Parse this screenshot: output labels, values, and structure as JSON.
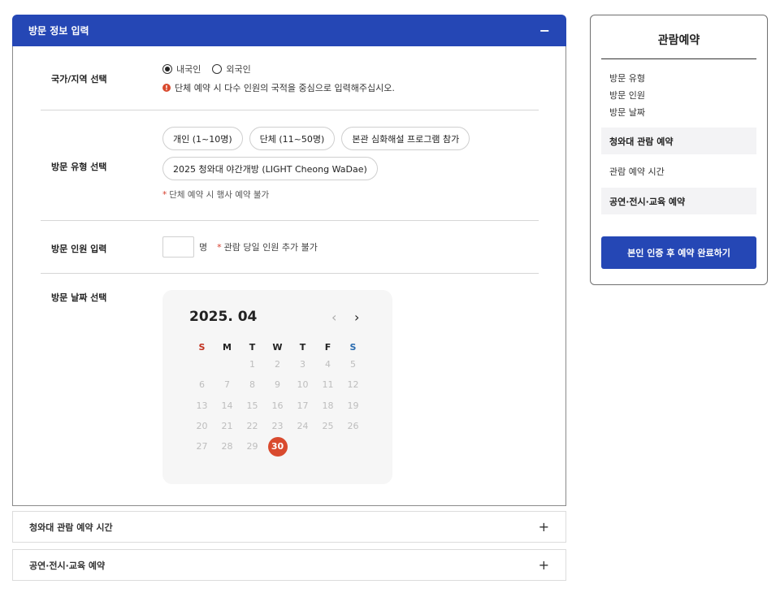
{
  "main_section": {
    "title": "방문 정보 입력",
    "toggle": "−",
    "nationality": {
      "label": "국가/지역 선택",
      "options": [
        "내국인",
        "외국인"
      ],
      "selected": "내국인",
      "notice_icon": "exclamation-icon",
      "notice": "단체 예약 시 다수 인원의 국적을 중심으로 입력해주십시오."
    },
    "visit_type": {
      "label": "방문 유형 선택",
      "chips": [
        "개인 (1~10명)",
        "단체 (11~50명)",
        "본관 심화해설 프로그램 참가",
        "2025 청와대 야간개방 (LIGHT Cheong WaDae)"
      ],
      "note": "단체 예약 시 행사 예약 불가"
    },
    "visitors": {
      "label": "방문 인원 입력",
      "value": "",
      "unit": "명",
      "note": "관람 당일 인원 추가 불가"
    },
    "visit_date": {
      "label": "방문 날짜 선택",
      "calendar": {
        "month_title": "2025. 04",
        "prev_icon": "chevron-left-icon",
        "next_icon": "chevron-right-icon",
        "weekdays": [
          "S",
          "M",
          "T",
          "W",
          "T",
          "F",
          "S"
        ],
        "leading_blanks": 2,
        "days": [
          "1",
          "2",
          "3",
          "4",
          "5",
          "6",
          "7",
          "8",
          "9",
          "10",
          "11",
          "12",
          "13",
          "14",
          "15",
          "16",
          "17",
          "18",
          "19",
          "20",
          "21",
          "22",
          "23",
          "24",
          "25",
          "26",
          "27",
          "28",
          "29",
          "30"
        ],
        "selected_day": "30"
      }
    }
  },
  "collapsed_sections": [
    {
      "title": "청와대 관람 예약 시간",
      "toggle": "+"
    },
    {
      "title": "공연·전시·교육 예약",
      "toggle": "+"
    }
  ],
  "sidebar": {
    "title": "관람예약",
    "summary": [
      "방문 유형",
      "방문 인원",
      "방문 날짜"
    ],
    "rows": [
      "청와대 관람 예약",
      "관람 예약 시간",
      "공연·전시·교육 예약"
    ],
    "button": "본인 인증 후 예약 완료하기"
  },
  "colors": {
    "primary": "#2547b5",
    "selected_day": "#d94a2e",
    "sunday": "#c23220",
    "saturday": "#2b6cb0"
  }
}
